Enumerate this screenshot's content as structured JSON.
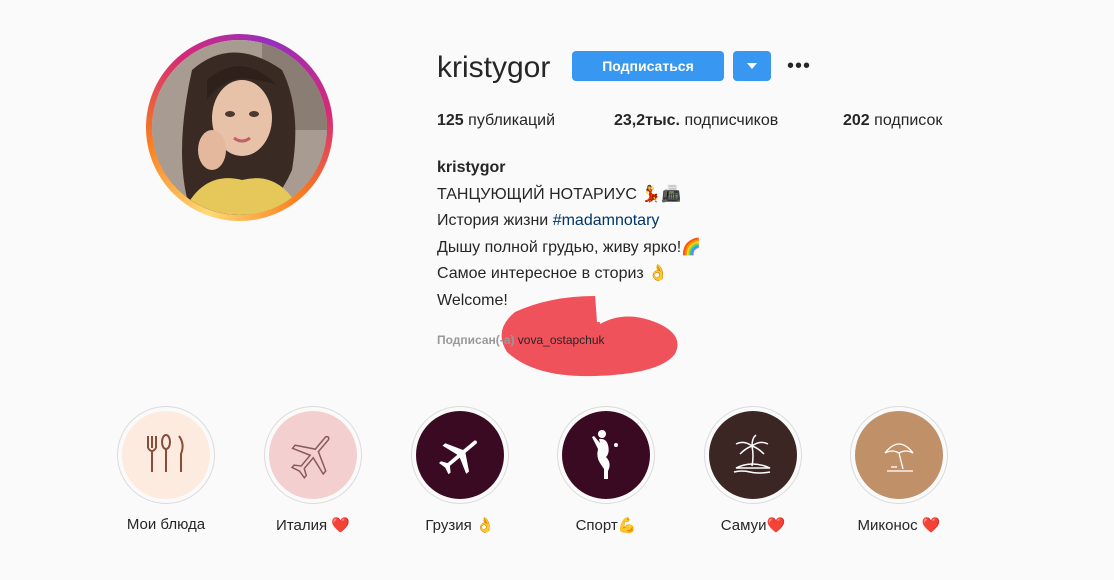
{
  "profile": {
    "username": "kristygor",
    "follow_label": "Подписаться",
    "dropdown_icon": "chevron-down-icon",
    "more_label": "•••",
    "stats": {
      "posts_count": "125",
      "posts_label": "публикаций",
      "followers_count": "23,2тыс.",
      "followers_label": "подписчиков",
      "following_count": "202",
      "following_label": "подписок"
    }
  },
  "bio": {
    "name": "kristygor",
    "line1": "ТАНЦУЮЩИЙ НОТАРИУС 💃📠",
    "line2_text": "История жизни ",
    "line2_tag": "#madamnotary",
    "line3": "Дышу полной грудью, живу ярко!🌈",
    "line4": "Самое интересное в сториз 👌",
    "line5": "Welcome!"
  },
  "followed_by": {
    "label": "Подписан(-а)",
    "user": "vova_ostapchuk"
  },
  "colors": {
    "accent": "#3897f0",
    "hashtag": "#003569",
    "scribble": "#f0525c"
  },
  "highlights": [
    {
      "label": "Мои блюда",
      "icon": "cutlery-icon",
      "bg": "#fdebe0"
    },
    {
      "label": "Италия ❤️",
      "icon": "airplane-icon",
      "bg": "#f3cfd0"
    },
    {
      "label": "Грузия 👌",
      "icon": "airplane-icon",
      "bg": "#3a0a22"
    },
    {
      "label": "Спорт💪",
      "icon": "woman-silhouette-icon",
      "bg": "#3a0a22"
    },
    {
      "label": "Самуи❤️",
      "icon": "palm-island-icon",
      "bg": "#3b2624"
    },
    {
      "label": "Миконос ❤️",
      "icon": "beach-umbrella-icon",
      "bg": "#c09068"
    }
  ]
}
